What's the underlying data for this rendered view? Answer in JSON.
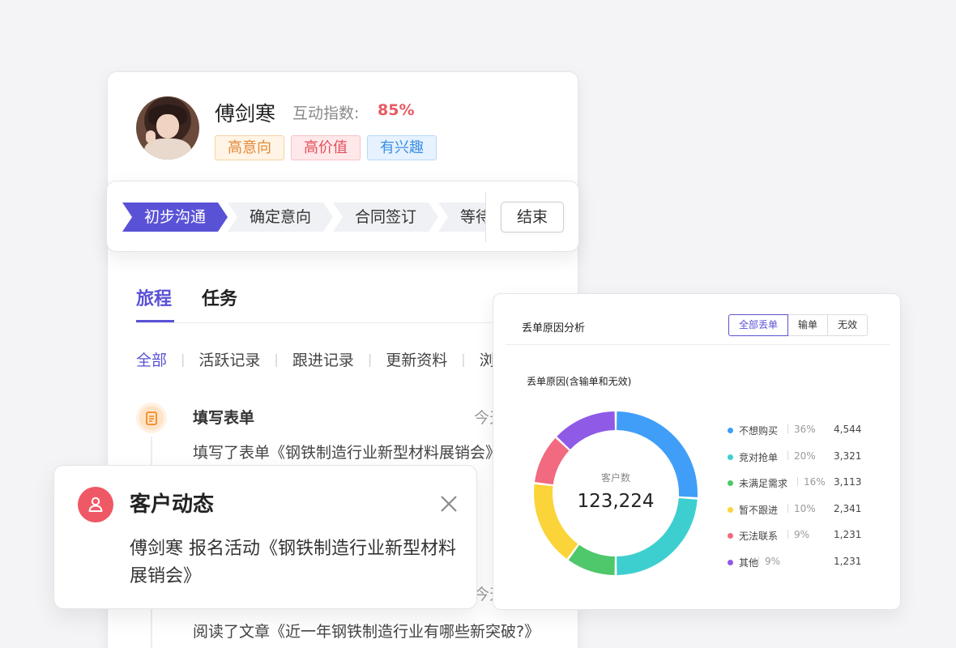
{
  "profile": {
    "name": "傅剑寒",
    "score_label": "互动指数:",
    "score_value": "85%",
    "tags": [
      "高意向",
      "高价值",
      "有兴趣"
    ]
  },
  "stages": {
    "steps": [
      "初步沟通",
      "确定意向",
      "合同签订",
      "等待"
    ],
    "end_label": "结束"
  },
  "tabs": [
    "旅程",
    "任务"
  ],
  "filters": [
    "全部",
    "活跃记录",
    "跟进记录",
    "更新资料",
    "浏"
  ],
  "timeline": {
    "item1_title": "填写表单",
    "item1_time": "今天",
    "item1_desc": "填写了表单《钢铁制造行业新型材料展销会》",
    "item2_time": "今天",
    "item2_desc": "阅读了文章《近一年钢铁制造行业有哪些新突破?》"
  },
  "notification": {
    "title": "客户动态",
    "text": "傅剑寒 报名活动《钢铁制造行业新型材料展销会》"
  },
  "analysis": {
    "title": "丢单原因分析",
    "segments": [
      "全部丢单",
      "输单",
      "无效"
    ],
    "subtitle": "丢单原因(含输单和无效)",
    "center_label": "客户数",
    "center_value": "123,224",
    "colors": {
      "不想购买": "#409ef8",
      "竞对抢单": "#3dcfcf",
      "未满足需求": "#4fc76b",
      "暂不跟进": "#fbd43a",
      "无法联系": "#f16a80",
      "其他": "#8e5ae6"
    }
  },
  "chart_data": {
    "type": "pie",
    "title": "丢单原因(含输单和无效)",
    "categories": [
      "不想购买",
      "竞对抢单",
      "未满足需求",
      "暂不跟进",
      "无法联系",
      "其他"
    ],
    "percent_labels": [
      "36%",
      "20%",
      "16%",
      "10%",
      "9%",
      "9%"
    ],
    "value_labels": [
      "4,544",
      "3,321",
      "3,113",
      "2,341",
      "1,231",
      "1,231"
    ],
    "values": [
      4544,
      3321,
      3113,
      2341,
      1231,
      1231
    ],
    "percents": [
      26,
      24,
      10,
      17,
      10,
      13
    ]
  }
}
